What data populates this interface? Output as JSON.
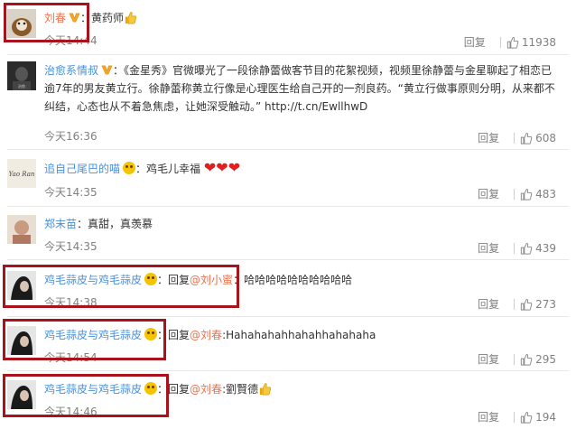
{
  "comments": [
    {
      "username": "刘春",
      "badge": "verified-v",
      "text": "黄药师",
      "emoji": "thumbs-up",
      "time": "今天14:44",
      "reply_label": "回复",
      "likes": "11938"
    },
    {
      "username": "治愈系情叔",
      "badge": "verified-v",
      "text": "《金星秀》官微曝光了一段徐静蕾做客节目的花絮视频，视频里徐静蕾与金星聊起了相恋已逾7年的男友黄立行。徐静蕾称黄立行像是心理医生给自己开的一剂良药。“黄立行做事原则分明，从来都不纠结，心态也从不着急焦虑，让她深受触动。” http://t.cn/EwllhwD",
      "time": "今天16:36",
      "reply_label": "回复",
      "likes": "608"
    },
    {
      "username": "追自己尾巴的喵",
      "badge": "smiley",
      "text": "鸡毛儿幸福",
      "emoji": "hearts",
      "time": "今天14:35",
      "reply_label": "回复",
      "likes": "483"
    },
    {
      "username": "郑末苗",
      "text": "真甜，真羡慕",
      "time": "今天14:35",
      "reply_label": "回复",
      "likes": "439"
    },
    {
      "username": "鸡毛蒜皮与鸡毛蒜皮",
      "badge": "smiley",
      "reply_prefix": "回复",
      "mention": "@刘小蜜",
      "text": "哈哈哈哈哈哈哈哈哈哈",
      "time": "今天14:38",
      "reply_label": "回复",
      "likes": "273"
    },
    {
      "username": "鸡毛蒜皮与鸡毛蒜皮",
      "badge": "smiley",
      "reply_prefix": "回复",
      "mention": "@刘春",
      "text": "Hahahahahhahahhahahaha",
      "time": "今天14:54",
      "reply_label": "回复",
      "likes": "295"
    },
    {
      "username": "鸡毛蒜皮与鸡毛蒜皮",
      "badge": "smiley",
      "reply_prefix": "回复",
      "mention": "@刘春",
      "text": "劉賢德",
      "emoji": "thumbs-up",
      "time": "今天14:46",
      "reply_label": "回复",
      "likes": "194"
    }
  ],
  "colors": {
    "username": "#eb7350",
    "highlight": "#a8131c",
    "muted": "#808080"
  }
}
